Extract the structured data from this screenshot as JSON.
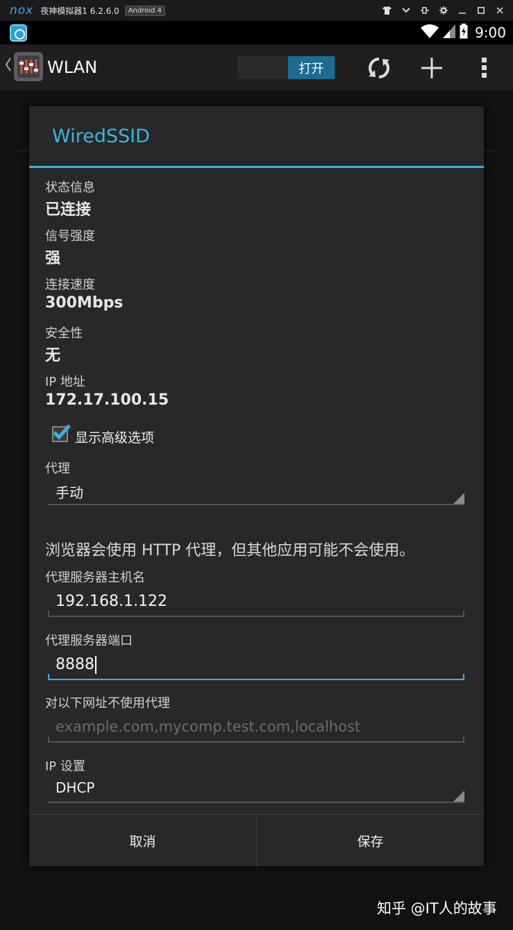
{
  "emulator": {
    "logo": "nox",
    "title": "夜神模拟器1 6.2.6.0",
    "badge": "Android 4"
  },
  "status_bar": {
    "time": "9:00"
  },
  "action_bar": {
    "title": "WLAN",
    "switch_label": "打开"
  },
  "dialog": {
    "title": "WiredSSID",
    "info": [
      {
        "label": "状态信息",
        "value": "已连接"
      },
      {
        "label": "信号强度",
        "value": "强"
      },
      {
        "label": "连接速度",
        "value": "300Mbps"
      },
      {
        "label": "安全性",
        "value": "无"
      },
      {
        "label": "IP 地址",
        "value": "172.17.100.15"
      }
    ],
    "advanced_label": "显示高级选项",
    "advanced_checked": true,
    "proxy_label": "代理",
    "proxy_value": "手动",
    "proxy_help": "浏览器会使用 HTTP 代理，但其他应用可能不会使用。",
    "host_label": "代理服务器主机名",
    "host_value": "192.168.1.122",
    "port_label": "代理服务器端口",
    "port_value": "8888",
    "bypass_label": "对以下网址不使用代理",
    "bypass_placeholder": "example.com,mycomp.test.com,localhost",
    "ip_settings_label": "IP 设置",
    "ip_settings_value": "DHCP",
    "cancel_label": "取消",
    "save_label": "保存"
  },
  "watermark": "知乎 @IT人的故事",
  "colors": {
    "accent": "#33b5e5",
    "dialog_bg": "#282828"
  }
}
